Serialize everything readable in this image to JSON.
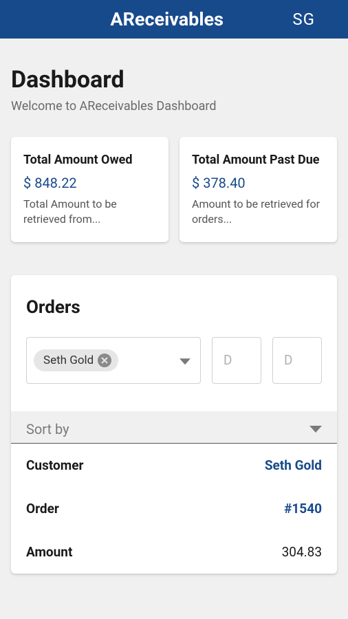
{
  "header": {
    "app_title": "AReceivables",
    "avatar_initials": "SG"
  },
  "page": {
    "title": "Dashboard",
    "subtitle": "Welcome to AReceivables Dashboard"
  },
  "cards": {
    "owed": {
      "title": "Total Amount Owed",
      "value": "$ 848.22",
      "desc": "Total Amount to be retrieved from..."
    },
    "past_due": {
      "title": "Total Amount Past Due",
      "value": "$ 378.40",
      "desc": "Amount to be retrieved for orders..."
    }
  },
  "orders": {
    "title": "Orders",
    "filter_chip": "Seth Gold",
    "date1_placeholder": "D",
    "date2_placeholder": "D",
    "sort_label": "Sort by",
    "details": {
      "customer_label": "Customer",
      "customer_value": "Seth Gold",
      "order_label": "Order",
      "order_value": "#1540",
      "amount_label": "Amount",
      "amount_value": "304.83"
    }
  }
}
